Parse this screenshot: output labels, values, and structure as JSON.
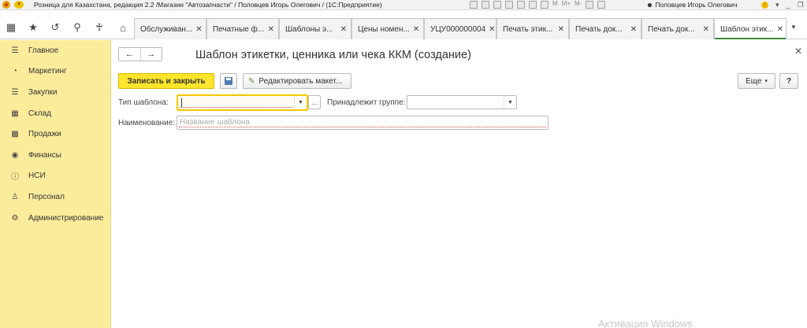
{
  "titlebar": {
    "title": "Розница для Казахстана, редакция 2.2 /Магазин \"Автозапчасти\" / Половцев Игорь Олегович /  (1С:Предприятие)",
    "tools": [
      "M",
      "M+",
      "M-"
    ],
    "user": "Половцев Игорь Олегович",
    "window_controls": [
      "i",
      "▾",
      "_",
      "❐",
      "✕"
    ]
  },
  "tabs": [
    {
      "label": "Обслуживан..."
    },
    {
      "label": "Печатные ф..."
    },
    {
      "label": "Шаблоны э..."
    },
    {
      "label": "Цены номен..."
    },
    {
      "label": "УЦУ000000004"
    },
    {
      "label": "Печать этик..."
    },
    {
      "label": "Печать док..."
    },
    {
      "label": "Печать док..."
    },
    {
      "label": "Шаблон этик...",
      "active": true
    }
  ],
  "sidebar": {
    "items": [
      {
        "label": "Главное",
        "icon": "menu-icon"
      },
      {
        "label": "Маркетинг",
        "icon": "pie-chart-icon"
      },
      {
        "label": "Закупки",
        "icon": "purchases-icon"
      },
      {
        "label": "Склад",
        "icon": "warehouse-icon"
      },
      {
        "label": "Продажи",
        "icon": "cart-icon"
      },
      {
        "label": "Финансы",
        "icon": "coins-icon"
      },
      {
        "label": "НСИ",
        "icon": "info-icon"
      },
      {
        "label": "Персонал",
        "icon": "person-icon"
      },
      {
        "label": "Администрирование",
        "icon": "gear-icon"
      }
    ]
  },
  "form": {
    "title": "Шаблон этикетки, ценника или чека ККМ (создание)",
    "save_close_label": "Записать и закрыть",
    "edit_layout_label": "Редактировать макет...",
    "more_label": "Еще",
    "help_label": "?",
    "template_type_label": "Тип шаблона:",
    "template_type_value": "",
    "group_label": "Принадлежит группе:",
    "group_value": "",
    "name_label": "Наименование:",
    "name_placeholder": "Название шаблона",
    "name_value": ""
  },
  "watermark": "Активация Windows",
  "colors": {
    "sidebar_bg": "#fbec9c",
    "primary_button": "#ffe52c",
    "focus_border": "#f5c800",
    "active_tab_underline": "#3c8c3c"
  }
}
